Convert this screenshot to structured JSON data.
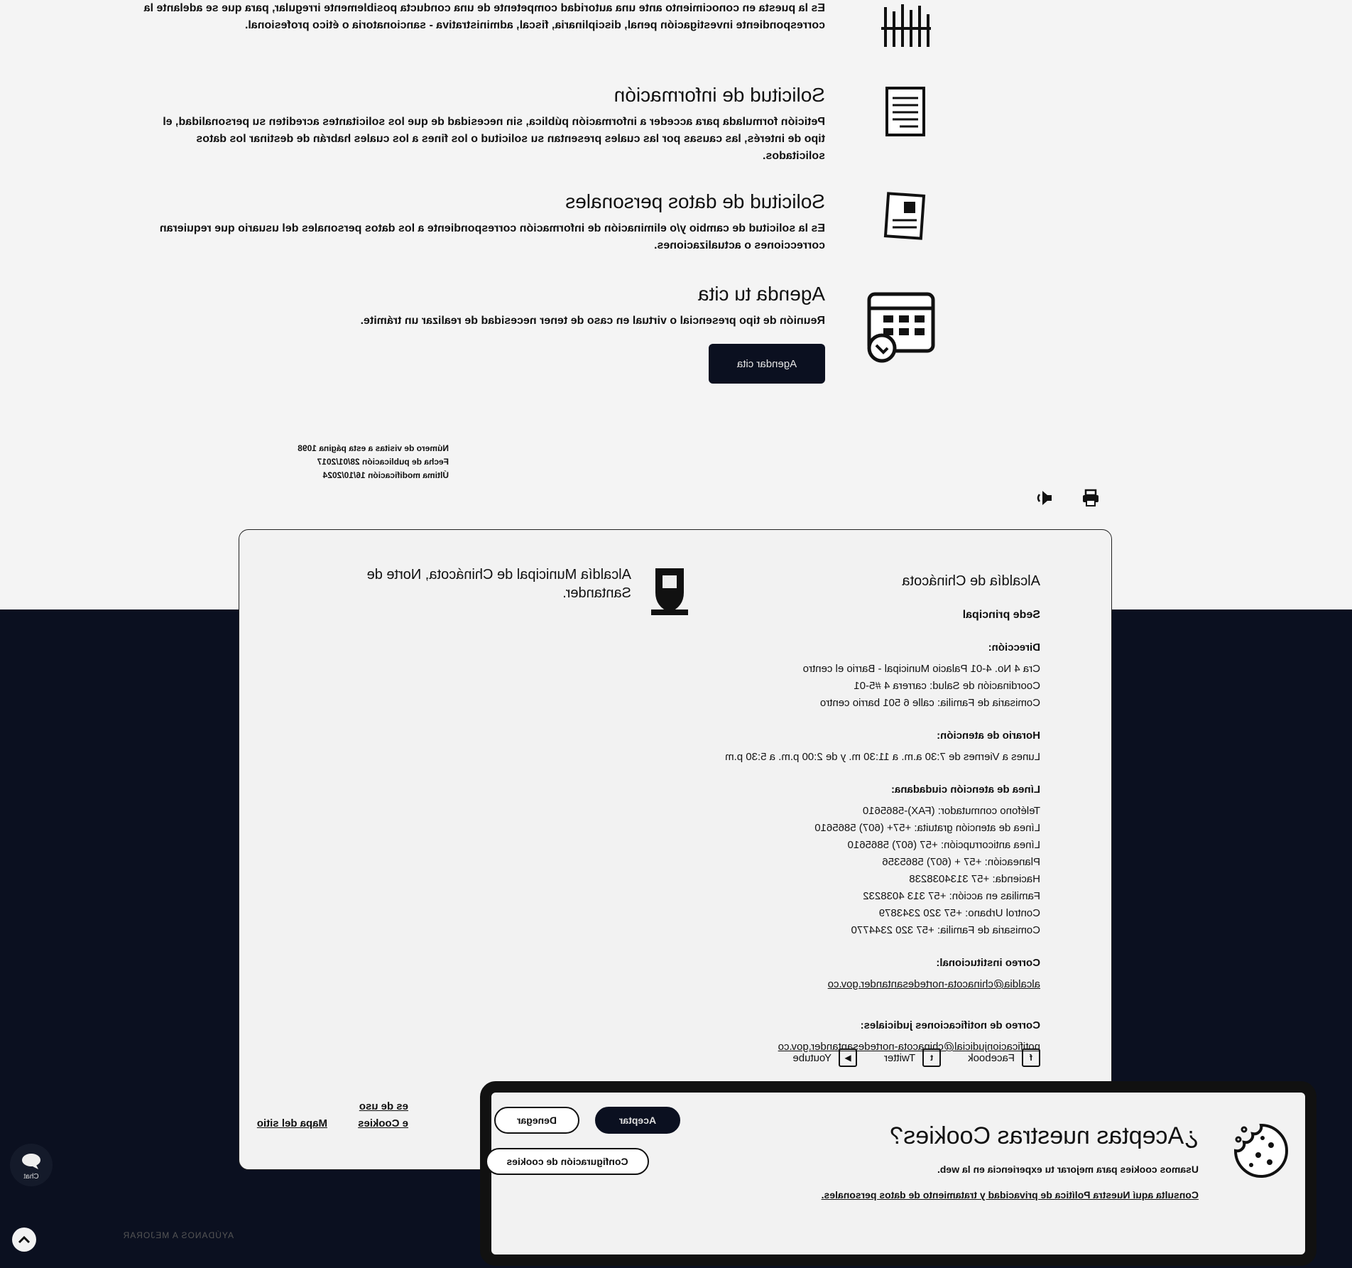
{
  "sections": {
    "denuncia": {
      "title": "",
      "desc": "Es la puesta en conocimiento ante una autoridad competente de una conducta posiblemente irregular, para que se adelante la correspondiente investigación penal, disciplinaria, fiscal, administrativa - sancionatoria o ético profesional."
    },
    "info": {
      "title": "Solicitud de información",
      "desc": "Petición formulada para acceder a información pública, sin necesidad de que los solicitantes acrediten su personalidad, el tipo de interés, las causas por las cuales presentan su solicitud o los fines a los cuales habrán de destinar los datos solicitados."
    },
    "datos": {
      "title": "Solicitud de datos personales",
      "desc": "Es la solicitud de cambio y/o eliminación de información correspondiente a los datos personales del usuario que requieran correcciones o actualizaciones."
    },
    "cita": {
      "title": "Agenda tu cita",
      "desc": "Reunión de tipo presencial o virtual en caso de tener necesidad de realizar un trámite.",
      "button": "Agendar cita"
    }
  },
  "meta": {
    "visits": "Número de visitas a esta página 1098",
    "published": "Fecha de publicación 28/01/2017",
    "modified": "Última modificación 16/10/2024"
  },
  "footer": {
    "title": "Alcaldía de Chinácota",
    "brand": "Alcaldía Municipal de Chinácota, Norte de Santander.",
    "sede": "Sede principal",
    "dir_label": "Dirección:",
    "dir": [
      "Cra 4 No. 4-01 Palacio Municipal - Barrio el centro",
      "Coordinación de Salud: carrera 4 #5-01",
      "Comisaria de Familia: calle 6 501 barrio centro"
    ],
    "horario_label": "Horario de atención:",
    "horario": "Lunes a Viernes de 7:30 a.m. a 11:30 m. y de 2:00 p.m. a 5:30 p.m",
    "lineas_label": "Línea de atención ciudadana:",
    "lineas": [
      "Teléfono conmutador: (FAX)-5865610",
      "Línea de atención gratuita: +57+ (607) 5865610",
      "Línea anticorrupción: +57 (607) 5865610",
      "Planeación: +57 + (607) 5865356",
      "Hacienda: +57 3134038238",
      "Familias en acción: +57 313 4038232",
      "Control Urbano: +57 320 2343879",
      "Comisaria de Familia: +57 320 2344770"
    ],
    "correo_label": "Correo institucional:",
    "correo": "alcaldia@chinacota-nortedesantander.gov.co",
    "notif_label": "Correo de notificaciones judiciales:",
    "notif": "notificacionjudicial@chinacota-nortedesantander.gov.co",
    "social": [
      "Facebook",
      "Twitter",
      "Youtube"
    ],
    "legal": [
      "es de uso",
      "e Cookies"
    ],
    "sitemap": "Mapa del sitio"
  },
  "cookie": {
    "title": "¿Aceptas nuestras Cookies?",
    "p1": "Usamos cookies para mejorar tu experiencia en la web.",
    "p2": "Consulta aquí Nuestra Política de privacidad y tratamiento de datos personales.",
    "accept": "Aceptar",
    "deny": "Denegar",
    "config": "Configuración de cookies"
  },
  "widgets": {
    "chat": "Chat",
    "help": "AYÚDANOS A MEJORAR"
  }
}
